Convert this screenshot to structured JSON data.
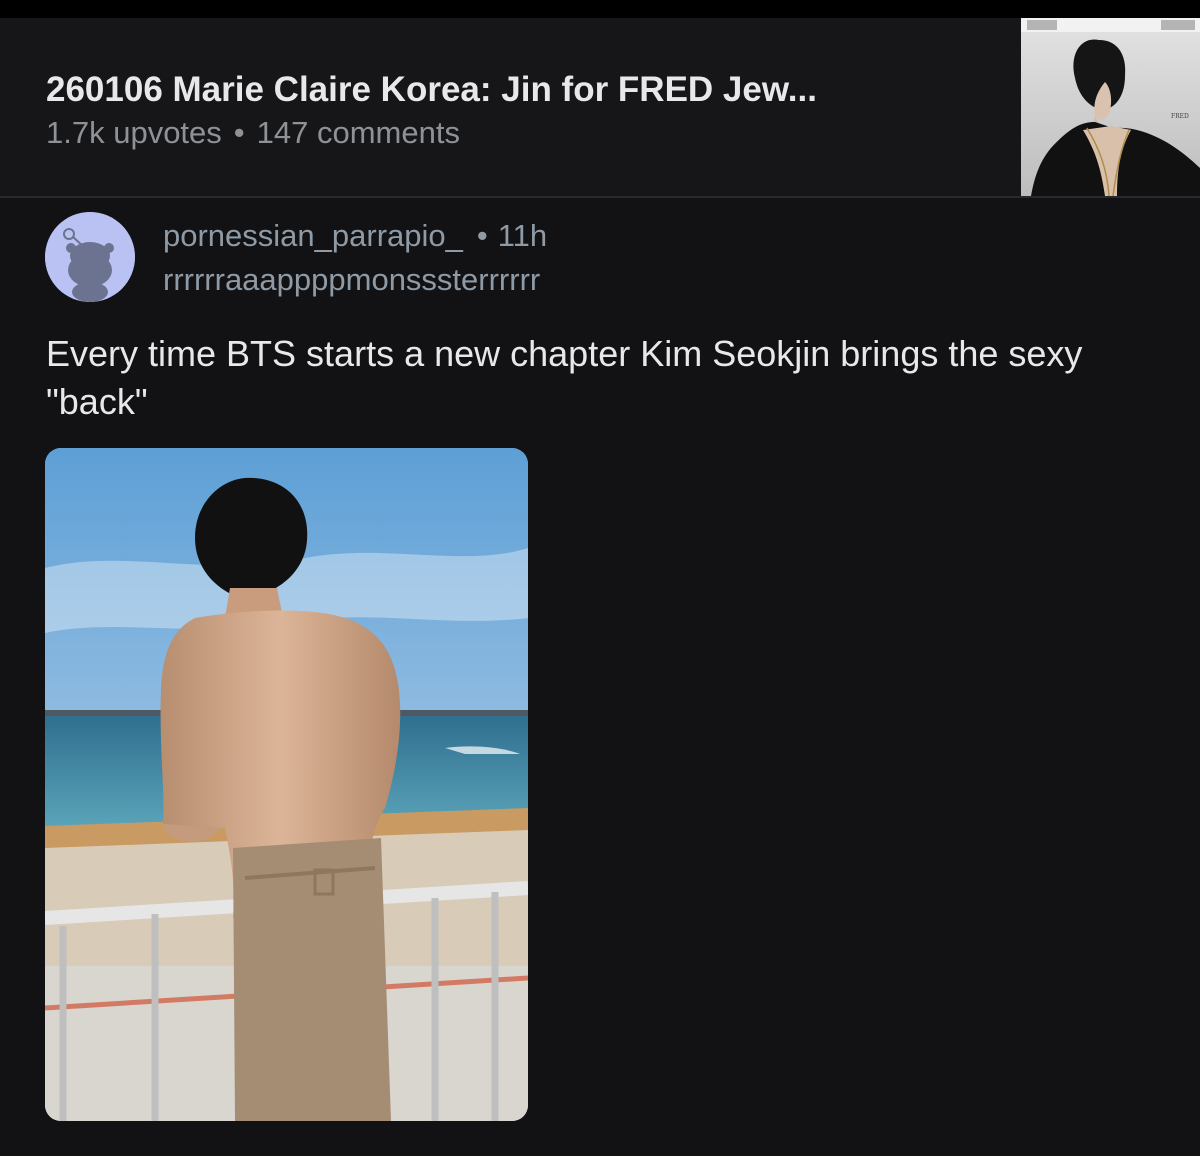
{
  "post": {
    "title": "260106 Marie Claire Korea: Jin for FRED Jew...",
    "upvotes": "1.7k upvotes",
    "separator": "•",
    "comments": "147 comments",
    "thumbnail_icon": "magazine-cover-thumbnail"
  },
  "comment": {
    "avatar_icon": "snoo-avatar-icon",
    "username": "pornessian_parrapio_",
    "separator": "•",
    "time": "11h",
    "flair": "rrrrrraaappppmonsssterrrrrr",
    "body": "Every time BTS starts a new chapter Kim Seokjin brings the sexy \"back\"",
    "image_icon": "beach-photo"
  },
  "colors": {
    "background": "#121214",
    "header_background": "#161618",
    "text_primary": "#e8e8ea",
    "text_secondary": "#8e9297",
    "avatar_background": "#b9c2f2"
  }
}
